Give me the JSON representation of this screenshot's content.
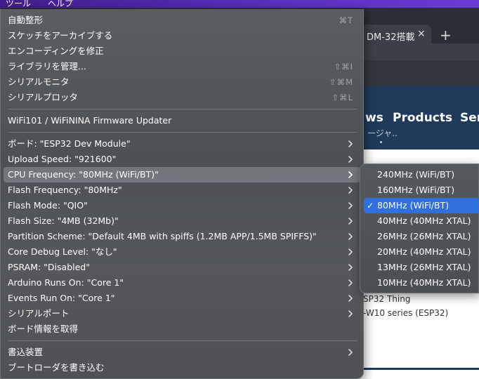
{
  "menubar": {
    "item1": "ツール",
    "item2": "ヘルプ"
  },
  "browser": {
    "tab_title": "DM-32搭載",
    "tab_close": "×",
    "new_tab": "+"
  },
  "website": {
    "nav": [
      "ws",
      "Products",
      "Ser"
    ],
    "nav_sub": "ージャ..",
    "content_lines": [
      "SP32 Thing",
      "-W10 series (ESP32)"
    ]
  },
  "menu": {
    "items": [
      {
        "label": "自動整形",
        "shortcut": "⌘T"
      },
      {
        "label": "スケッチをアーカイブする"
      },
      {
        "label": "エンコーディングを修正"
      },
      {
        "label": "ライブラリを管理...",
        "shortcut": "⇧⌘I"
      },
      {
        "label": "シリアルモニタ",
        "shortcut": "⇧⌘M"
      },
      {
        "label": "シリアルプロッタ",
        "shortcut": "⇧⌘L"
      },
      {
        "label": "WiFi101 / WiFiNINA Firmware Updater"
      },
      {
        "label": "ボード: \"ESP32 Dev Module\""
      },
      {
        "label": "Upload Speed: \"921600\""
      },
      {
        "label": "CPU Frequency: \"80MHz (WiFi/BT)\""
      },
      {
        "label": "Flash Frequency: \"80MHz\""
      },
      {
        "label": "Flash Mode: \"QIO\""
      },
      {
        "label": "Flash Size: \"4MB (32Mb)\""
      },
      {
        "label": "Partition Scheme: \"Default 4MB with spiffs (1.2MB APP/1.5MB SPIFFS)\""
      },
      {
        "label": "Core Debug Level: \"なし\""
      },
      {
        "label": "PSRAM: \"Disabled\""
      },
      {
        "label": "Arduino Runs On: \"Core 1\""
      },
      {
        "label": "Events Run On: \"Core 1\""
      },
      {
        "label": "シリアルポート"
      },
      {
        "label": "ボード情報を取得"
      },
      {
        "label": "書込装置"
      },
      {
        "label": "ブートローダを書き込む"
      }
    ]
  },
  "submenu": {
    "check": "✓",
    "items": [
      "240MHz (WiFi/BT)",
      "160MHz (WiFi/BT)",
      "80MHz (WiFi/BT)",
      "40MHz (40MHz XTAL)",
      "26MHz (26MHz XTAL)",
      "20MHz (40MHz XTAL)",
      "13MHz (26MHz XTAL)",
      "10MHz (40MHz XTAL)"
    ]
  },
  "colors": {
    "highlight": "#2f6fde",
    "menu_bg": "#505357",
    "site_nav": "#1f3a5a"
  }
}
